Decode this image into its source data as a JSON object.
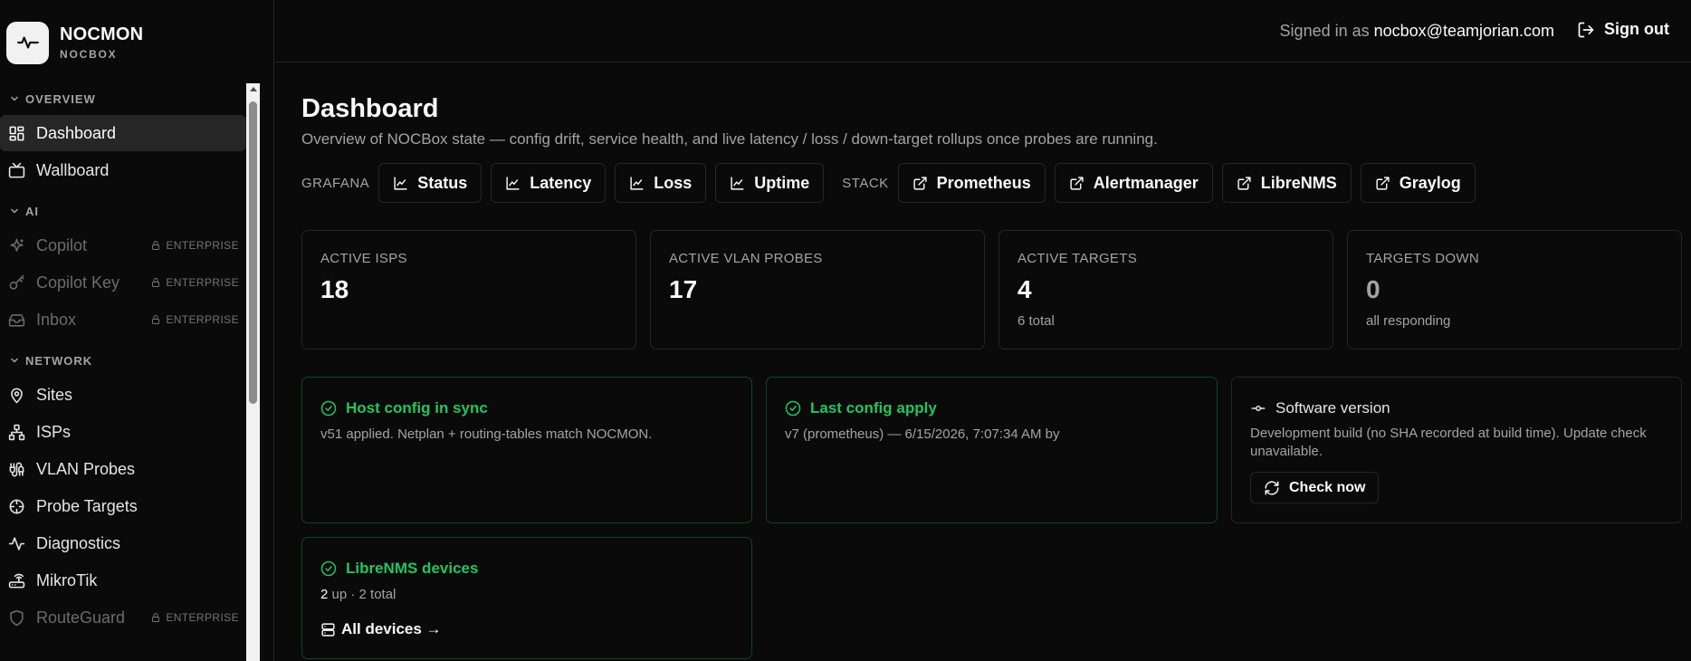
{
  "brand": {
    "name": "NOCMON",
    "sub": "NOCBOX",
    "logo_icon": "activity-icon"
  },
  "sidebar": {
    "sections": [
      {
        "label": "OVERVIEW",
        "items": [
          {
            "label": "Dashboard",
            "icon": "layout-dashboard-icon",
            "active": true
          },
          {
            "label": "Wallboard",
            "icon": "tv-icon"
          }
        ]
      },
      {
        "label": "AI",
        "items": [
          {
            "label": "Copilot",
            "icon": "sparkles-icon",
            "badge": "ENTERPRISE"
          },
          {
            "label": "Copilot Key",
            "icon": "key-icon",
            "badge": "ENTERPRISE"
          },
          {
            "label": "Inbox",
            "icon": "inbox-icon",
            "badge": "ENTERPRISE"
          }
        ]
      },
      {
        "label": "NETWORK",
        "items": [
          {
            "label": "Sites",
            "icon": "map-pin-icon"
          },
          {
            "label": "ISPs",
            "icon": "network-icon"
          },
          {
            "label": "VLAN Probes",
            "icon": "cable-icon"
          },
          {
            "label": "Probe Targets",
            "icon": "crosshair-icon"
          },
          {
            "label": "Diagnostics",
            "icon": "activity-icon"
          },
          {
            "label": "MikroTik",
            "icon": "router-icon"
          },
          {
            "label": "RouteGuard",
            "icon": "shield-icon",
            "badge": "ENTERPRISE"
          }
        ]
      }
    ]
  },
  "topbar": {
    "signed_in_prefix": "Signed in as ",
    "email": "nocbox@teamjorian.com",
    "sign_out": "Sign out"
  },
  "page": {
    "title": "Dashboard",
    "subtitle": "Overview of NOCBox state — config drift, service health, and live latency / loss / down-target rollups once probes are running."
  },
  "links": {
    "grafana_label": "GRAFANA",
    "grafana": [
      {
        "label": "Status",
        "icon": "line-chart-icon"
      },
      {
        "label": "Latency",
        "icon": "line-chart-icon"
      },
      {
        "label": "Loss",
        "icon": "line-chart-icon"
      },
      {
        "label": "Uptime",
        "icon": "line-chart-icon"
      }
    ],
    "stack_label": "STACK",
    "stack": [
      {
        "label": "Prometheus",
        "icon": "external-link-icon"
      },
      {
        "label": "Alertmanager",
        "icon": "external-link-icon"
      },
      {
        "label": "LibreNMS",
        "icon": "external-link-icon"
      },
      {
        "label": "Graylog",
        "icon": "external-link-icon"
      }
    ]
  },
  "stats": [
    {
      "label": "ACTIVE ISPS",
      "value": "18",
      "note": ""
    },
    {
      "label": "ACTIVE VLAN PROBES",
      "value": "17",
      "note": ""
    },
    {
      "label": "ACTIVE TARGETS",
      "value": "4",
      "note": "6 total"
    },
    {
      "label": "TARGETS DOWN",
      "value": "0",
      "note": "all responding"
    }
  ],
  "cards": {
    "host_config": {
      "title": "Host config in sync",
      "body": "v51 applied. Netplan + routing-tables match NOCMON."
    },
    "last_apply": {
      "title": "Last config apply",
      "body": "v7 (prometheus) — 6/15/2026, 7:07:34 AM by"
    },
    "software": {
      "title": "Software version",
      "body": "Development build (no SHA recorded at build time). Update check unavailable.",
      "button": "Check now"
    },
    "librenms": {
      "title": "LibreNMS devices",
      "up_count": "2",
      "body_rest": " up · 2 total",
      "link": "All devices →"
    }
  },
  "colors": {
    "accent_green": "#22c55e",
    "card_border_green": "#14432a",
    "bg": "#0a0a0a"
  }
}
